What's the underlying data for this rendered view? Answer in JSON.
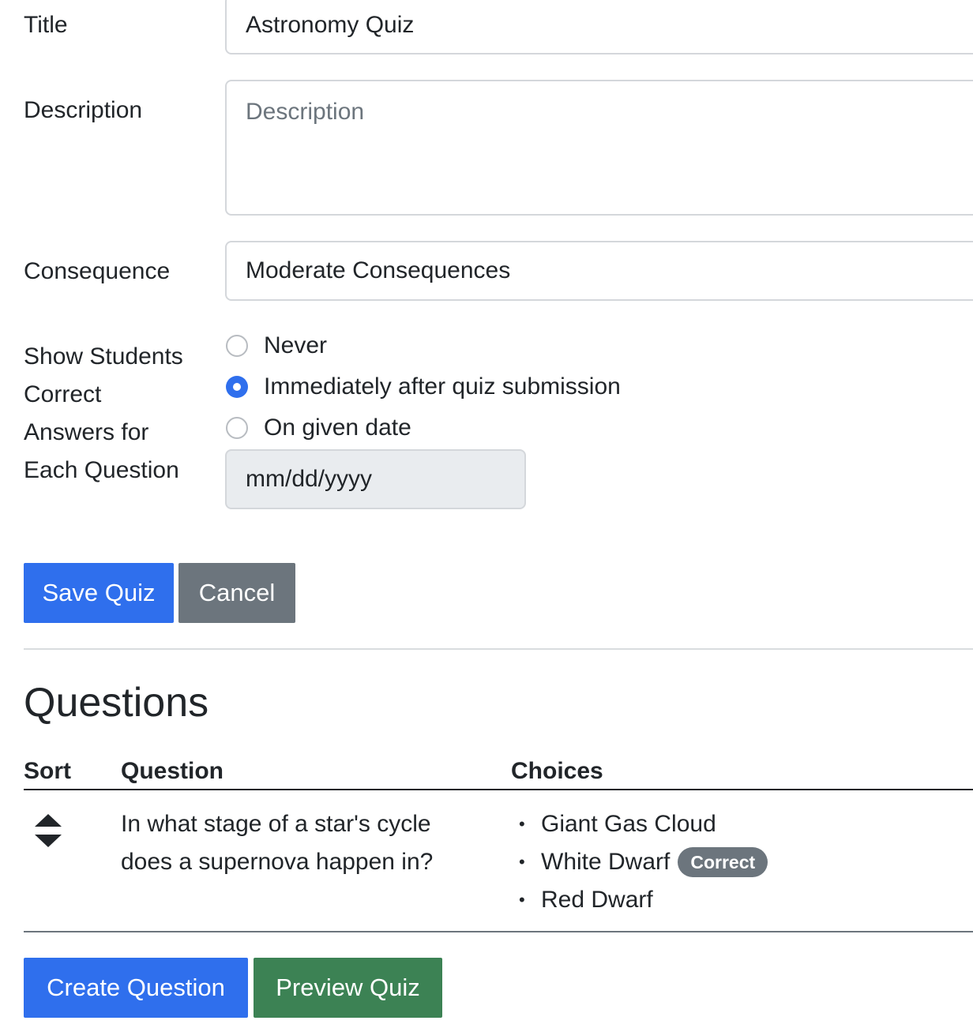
{
  "form": {
    "title_label": "Title",
    "title_value": "Astronomy Quiz",
    "description_label": "Description",
    "description_placeholder": "Description",
    "consequence_label": "Consequence",
    "consequence_value": "Moderate Consequences",
    "show_answers_label": "Show Students Correct Answers for Each Question",
    "show_answers_options": [
      {
        "label": "Never",
        "checked": false
      },
      {
        "label": "Immediately after quiz submission",
        "checked": true
      },
      {
        "label": "On given date",
        "checked": false
      }
    ],
    "date_placeholder": "mm/dd/yyyy",
    "save_label": "Save Quiz",
    "cancel_label": "Cancel"
  },
  "questions": {
    "heading": "Questions",
    "columns": [
      "Sort",
      "Question",
      "Choices"
    ],
    "rows": [
      {
        "question": "In what stage of a star's cycle does a supernova happen in?",
        "choices": [
          {
            "text": "Giant Gas Cloud",
            "correct": false
          },
          {
            "text": "White Dwarf",
            "correct": true
          },
          {
            "text": "Red Dwarf",
            "correct": false
          }
        ],
        "correct_badge": "Correct"
      }
    ],
    "create_label": "Create Question",
    "preview_label": "Preview Quiz"
  },
  "colors": {
    "primary": "#2f6fed",
    "secondary": "#6c757d",
    "success": "#3c8254"
  }
}
